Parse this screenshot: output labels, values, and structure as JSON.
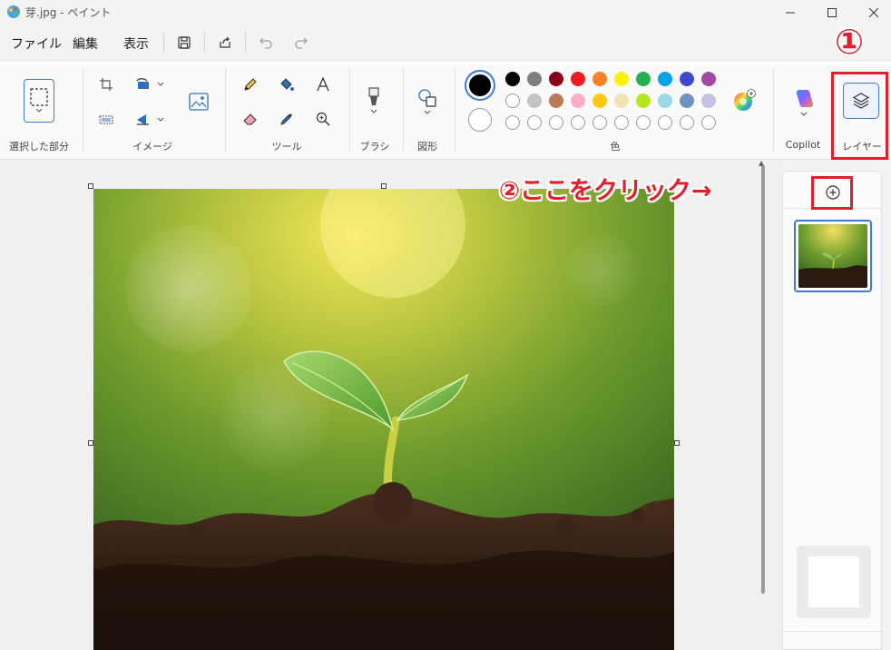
{
  "window": {
    "title": "芽.jpg - ペイント"
  },
  "menu": {
    "file": "ファイル",
    "edit": "編集",
    "view": "表示"
  },
  "ribbon": {
    "groups": {
      "selection": "選択した部分",
      "image": "イメージ",
      "tools": "ツール",
      "brush": "ブラシ",
      "shapes": "図形",
      "colors": "色",
      "copilot": "Copilot",
      "layers": "レイヤー"
    },
    "palette_row1": [
      "#000000",
      "#7f7f7f",
      "#880015",
      "#ed1c24",
      "#ff7f27",
      "#fff200",
      "#22b14c",
      "#00a2e8",
      "#3f48cc",
      "#a349a4"
    ],
    "palette_row2": [
      "#ffffff",
      "#c3c3c3",
      "#b97a57",
      "#ffaec9",
      "#ffc90e",
      "#efe4b0",
      "#b5e61d",
      "#99d9ea",
      "#7092be",
      "#c8bfe7"
    ],
    "primary_color": "#000000",
    "secondary_color": "#ffffff"
  },
  "annotations": {
    "step1": "①",
    "step2": "②ここをクリック→",
    "highlight_color": "#e0202a"
  }
}
